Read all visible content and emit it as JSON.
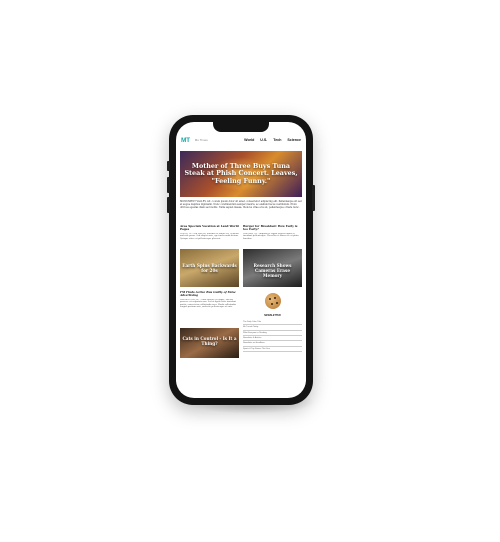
{
  "header": {
    "logo": "MT",
    "site_name": "Mu Times",
    "nav": [
      "World",
      "U.S.",
      "Tech",
      "Science"
    ]
  },
  "hero": {
    "title": "Mother of Three Buys Tuna Steak at Phish Concert. Leaves, \"Feeling Funny.\""
  },
  "intro": {
    "text": "MONUMENT VALLEY, AZ - Lorem ipsum dolor sit amet, consectetur adipiscing elit. Pellentesque sit sed at augue dapibus dignissim. Nunc condimentum semper mauris, ac eleifend lacus vestibulum. Proin ultrices egestas diam sed mollis. Nulla sapien massa, rhoncus vitae eros at, pellentesque ornare nunc."
  },
  "stories": [
    {
      "headline": "Area Specials Vacation at Land World Pages",
      "text": "PLANO, TX - Sed erat leo, faucibus et ornare vel, vehicula molestie purus. Sed aliquet ante, eget malesuada dictum. Quisque vitae est pellentesque placerat.",
      "image_caption": "Earth Spins Backwards for 20s"
    },
    {
      "headline": "Burger for Breakfast: How Early is too Early?",
      "text": "New York, NY - Aliquam et sapien facilisis ligula at, tincidunt pellentesque. Phasellus et libero eu est porta faucibus.",
      "image_caption": "Research Shows Cameras Erase Memory"
    }
  ],
  "feature": {
    "title": "FM Finds Active Bus Guilty of False Advertising",
    "text": "WASHINGTON DC - Nunc ornare est augue, viverra posuere est vulputate non. Sed ut ligula vitae tincidunt mattis, consectetur sollicitudin arcu. Morbi sollicitudin feugiat pretium ante, molestie pellentesque at ante.",
    "image_caption": "Cats in Control - Is It a Thing?"
  },
  "newsletter": {
    "label": "NEWSLETTER",
    "items": [
      "The Daily Cake Tide",
      "Mu Trends Today",
      "What Everyone is Reading",
      "Newsletter & Articles",
      "Newsletter on Headlines",
      "Sports & Top Stories This Year"
    ]
  }
}
